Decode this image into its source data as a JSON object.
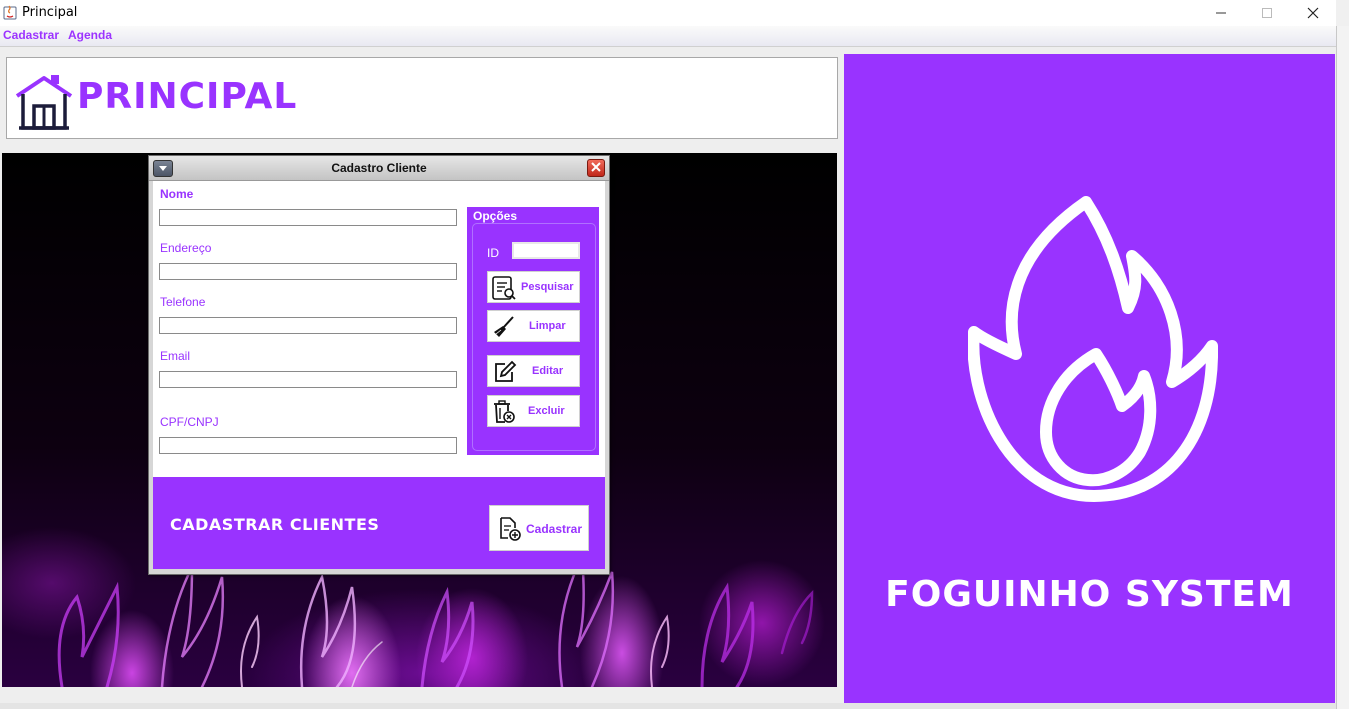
{
  "window": {
    "title": "Principal"
  },
  "menu": {
    "items": [
      "Cadastrar",
      "Agenda"
    ]
  },
  "header": {
    "title": "PRINCIPAL"
  },
  "brand": {
    "name": "FOGUINHO SYSTEM"
  },
  "colors": {
    "accent": "#9933ff",
    "flame": "#cc33ff"
  },
  "internal_frame": {
    "title": "Cadastro Cliente",
    "fields": [
      {
        "label": "Nome",
        "value": ""
      },
      {
        "label": "Endereço",
        "value": ""
      },
      {
        "label": "Telefone",
        "value": ""
      },
      {
        "label": "Email",
        "value": ""
      },
      {
        "label": "CPF/CNPJ",
        "value": ""
      }
    ],
    "options": {
      "title": "Opções",
      "id_label": "ID",
      "id_value": "",
      "buttons": [
        "Pesquisar",
        "Limpar",
        "Editar",
        "Excluir"
      ]
    },
    "footer": {
      "title": "CADASTRAR CLIENTES",
      "submit_label": "Cadastrar"
    }
  }
}
